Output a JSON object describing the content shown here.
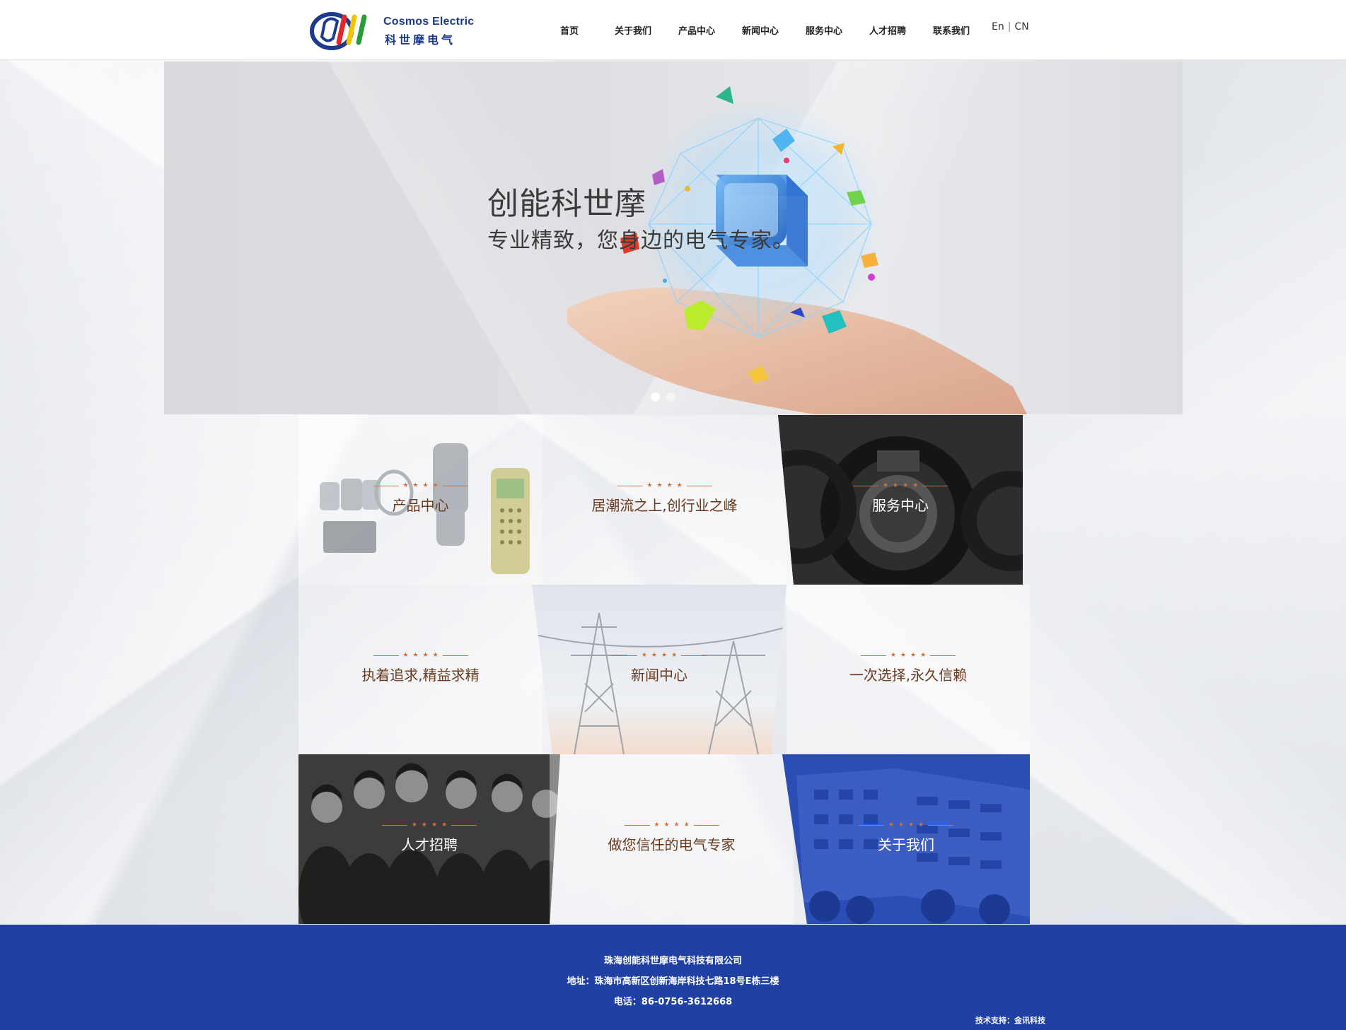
{
  "header": {
    "logo": {
      "name_en": "Cosmos Electric",
      "name_cn": "科世摩电气",
      "colors": [
        "#1d3a8f",
        "#e2262a",
        "#f3c300",
        "#2a9a3b"
      ]
    },
    "nav": [
      {
        "label": "首页"
      },
      {
        "label": "关于我们"
      },
      {
        "label": "产品中心"
      },
      {
        "label": "新闻中心"
      },
      {
        "label": "服务中心"
      },
      {
        "label": "人才招聘"
      },
      {
        "label": "联系我们"
      }
    ],
    "lang": {
      "en": "En",
      "sep": "|",
      "cn": "CN"
    }
  },
  "banner": {
    "title": "创能科世摩",
    "subtitle": "专业精致，您身边的电气专家。",
    "slide_count": 2,
    "active_slide": 1
  },
  "tiles": [
    {
      "label": "产品中心"
    },
    {
      "label": "居潮流之上,创行业之峰"
    },
    {
      "label": "服务中心"
    },
    {
      "label": "执着追求,精益求精"
    },
    {
      "label": "新闻中心"
    },
    {
      "label": "一次选择,永久信赖"
    },
    {
      "label": "人才招聘"
    },
    {
      "label": "做您信任的电气专家"
    },
    {
      "label": "关于我们"
    }
  ],
  "footer": {
    "company": "珠海创能科世摩电气科技有限公司",
    "address": "地址：珠海市高新区创新海岸科技七路18号E栋三楼",
    "phone": "电话：86-0756-3612668",
    "tech_support": "技术支持：金讯科技"
  },
  "colors": {
    "brand_blue": "#2041a3",
    "accent_orange": "#d8702a"
  }
}
